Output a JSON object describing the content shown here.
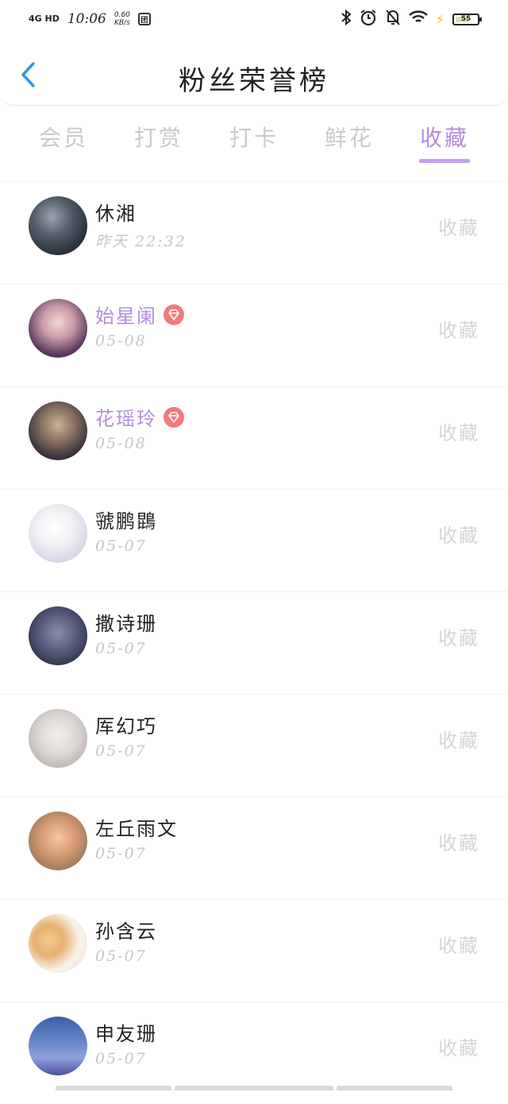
{
  "status_bar": {
    "network": "4G HD",
    "time": "10:06",
    "speed_value": "0.60",
    "speed_unit": "KB/s",
    "app_indicator": "团",
    "battery": "55",
    "icons": [
      "bluetooth-icon",
      "alarm-icon",
      "mute-icon",
      "wifi-icon",
      "charging-icon",
      "battery-icon"
    ]
  },
  "header": {
    "title": "粉丝荣誉榜",
    "back_icon": "chevron-left-icon",
    "accent_color": "#2f9bd9"
  },
  "tabs": [
    {
      "label": "会员",
      "active": false
    },
    {
      "label": "打赏",
      "active": false
    },
    {
      "label": "打卡",
      "active": false
    },
    {
      "label": "鲜花",
      "active": false
    },
    {
      "label": "收藏",
      "active": true
    }
  ],
  "colors": {
    "active_tab": "#b48ce2",
    "inactive_tab": "#c9c9c9",
    "vip_name": "#b48ce2",
    "vip_badge": "#f17a7e"
  },
  "fans": [
    {
      "name": "休湘",
      "date": "昨天 22:32",
      "vip": false,
      "action": "收藏"
    },
    {
      "name": "始星阑",
      "date": "05-08",
      "vip": true,
      "action": "收藏"
    },
    {
      "name": "花瑶玲",
      "date": "05-08",
      "vip": true,
      "action": "收藏"
    },
    {
      "name": "虢鹏鵾",
      "date": "05-07",
      "vip": false,
      "action": "收藏"
    },
    {
      "name": "撒诗珊",
      "date": "05-07",
      "vip": false,
      "action": "收藏"
    },
    {
      "name": "厍幻巧",
      "date": "05-07",
      "vip": false,
      "action": "收藏"
    },
    {
      "name": "左丘雨文",
      "date": "05-07",
      "vip": false,
      "action": "收藏"
    },
    {
      "name": "孙含云",
      "date": "05-07",
      "vip": false,
      "action": "收藏"
    },
    {
      "name": "申友珊",
      "date": "05-07",
      "vip": false,
      "action": "收藏"
    }
  ]
}
